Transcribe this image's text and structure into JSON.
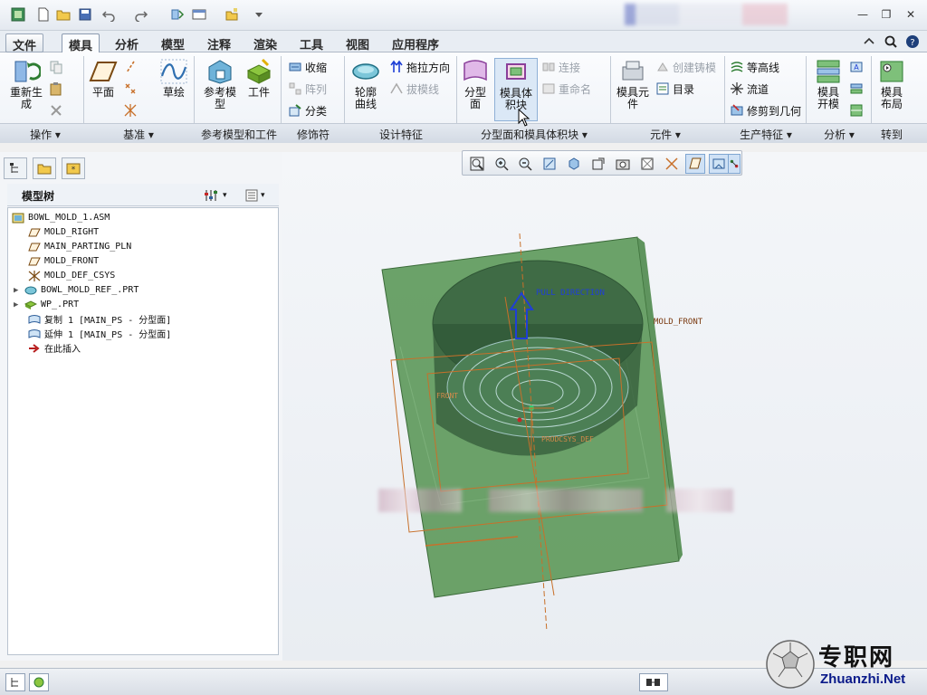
{
  "quick_access": {
    "icons": [
      "app-icon",
      "new-icon",
      "open-icon",
      "save-icon",
      "undo-icon",
      "redo-icon",
      "regenerate-icon",
      "windows-icon",
      "close-window-icon",
      "customize-icon"
    ]
  },
  "window_controls": [
    "minimize",
    "restore",
    "close"
  ],
  "menu": {
    "file": "文件",
    "tabs": [
      "模具",
      "分析",
      "模型",
      "注释",
      "渲染",
      "工具",
      "视图",
      "应用程序"
    ],
    "active_tab": "模具",
    "right_icons": [
      "minimize-ribbon-icon",
      "search-icon",
      "help-icon"
    ]
  },
  "ribbon": {
    "regenerate": "重新生成",
    "copy_paste": "",
    "plane": "平面",
    "sketch": "草绘",
    "ref_model": "参考模型",
    "workpiece": "工件",
    "shrink": "收缩",
    "pattern": "阵列",
    "classify": "分类",
    "drag_direction": "拖拉方向",
    "draft_line": "拔模线",
    "contour_curve": "轮廓曲线",
    "parting_surface": "分型面",
    "mold_volume": "模具体积块",
    "connect": "连接",
    "rename": "重命名",
    "mold_component": "模具元件",
    "create_casting": "创建铸模",
    "catalog": "目录",
    "contour_lines": "等高线",
    "flow_path": "流道",
    "trim_geometry": "修剪到几何",
    "mold_opening": "模具开模",
    "mold_layout": "模具布局"
  },
  "groups": [
    "操作",
    "基准",
    "参考模型和工件",
    "修饰符",
    "设计特征",
    "分型面和模具体积块",
    "元件",
    "生产特征",
    "分析",
    "转到"
  ],
  "model_tree": {
    "title": "模型树",
    "items": [
      {
        "label": "BOWL_MOLD_1.ASM",
        "icon": "assembly-icon",
        "expandable": false
      },
      {
        "label": "MOLD_RIGHT",
        "icon": "datum-plane-icon",
        "expandable": false
      },
      {
        "label": "MAIN_PARTING_PLN",
        "icon": "datum-plane-icon",
        "expandable": false
      },
      {
        "label": "MOLD_FRONT",
        "icon": "datum-plane-icon",
        "expandable": false
      },
      {
        "label": "MOLD_DEF_CSYS",
        "icon": "csys-icon",
        "expandable": false
      },
      {
        "label": "BOWL_MOLD_REF_.PRT",
        "icon": "part-icon",
        "expandable": true
      },
      {
        "label": "WP_.PRT",
        "icon": "workpiece-icon",
        "expandable": true
      },
      {
        "label": "复制 1 [MAIN_PS - 分型面]",
        "icon": "surface-icon",
        "expandable": false
      },
      {
        "label": "延伸 1 [MAIN_PS - 分型面]",
        "icon": "surface-icon",
        "expandable": false
      },
      {
        "label": "在此插入",
        "icon": "insert-here-icon",
        "expandable": false
      }
    ]
  },
  "viewport": {
    "labels": {
      "pull_direction": "PULL DIRECTION",
      "mold_front": "MOLD_FRONT",
      "front": "FRONT",
      "csys": "PRODCSYS_DEF"
    }
  },
  "watermark": {
    "cn": "专职网",
    "en": "Zhuanzhi.Net"
  },
  "colors": {
    "mold_green": "#5f9a5c",
    "datum_orange": "#c8702a",
    "pull_blue": "#1f3fd6"
  }
}
